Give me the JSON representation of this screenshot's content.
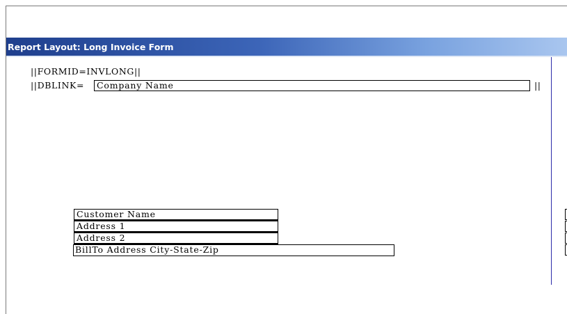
{
  "window": {
    "title": "Report Layout: Long Invoice Form"
  },
  "layout": {
    "formid_line": "||FORMID=INVLONG||",
    "dblink_prefix": "||DBLINK=",
    "dblink_field": "Company Name",
    "dblink_suffix": "||",
    "fields": {
      "customer_name": "Customer Name",
      "address1": "Address 1",
      "address2": "Address 2",
      "billto_city_state_zip": "BillTo Address City-State-Zip"
    }
  }
}
